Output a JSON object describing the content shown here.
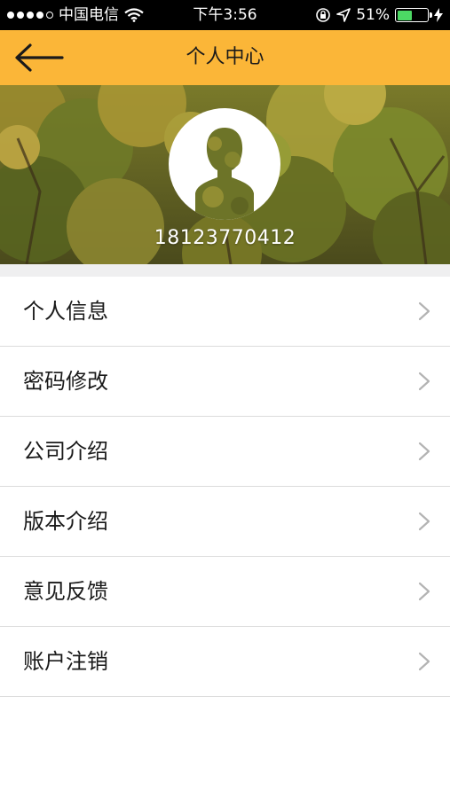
{
  "status_bar": {
    "carrier": "中国电信",
    "time": "下午3:56",
    "battery_percent": "51%",
    "battery_level": 0.51,
    "battery_color": "#4cd964"
  },
  "nav": {
    "title": "个人中心",
    "back_icon": "arrow-left-icon",
    "background_color": "#fbb638"
  },
  "profile": {
    "avatar_icon": "person-silhouette-icon",
    "phone": "18123770412"
  },
  "menu": {
    "items": [
      {
        "label": "个人信息",
        "icon": "chevron-right-icon"
      },
      {
        "label": "密码修改",
        "icon": "chevron-right-icon"
      },
      {
        "label": "公司介绍",
        "icon": "chevron-right-icon"
      },
      {
        "label": "版本介绍",
        "icon": "chevron-right-icon"
      },
      {
        "label": "意见反馈",
        "icon": "chevron-right-icon"
      },
      {
        "label": "账户注销",
        "icon": "chevron-right-icon"
      }
    ]
  }
}
